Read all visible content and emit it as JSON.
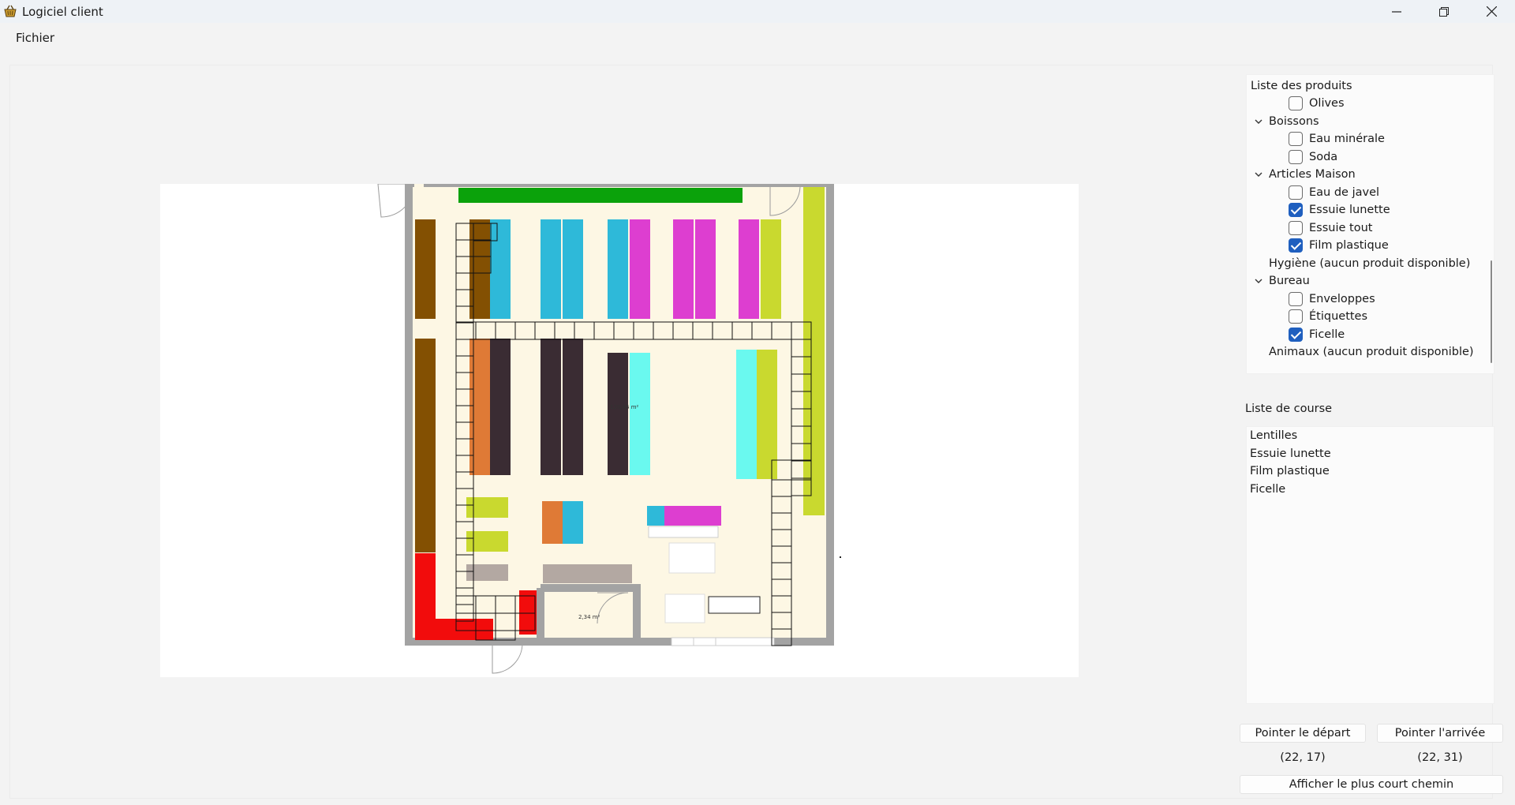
{
  "window": {
    "title": "Logiciel client",
    "icon": "shopping-basket-icon",
    "controls": [
      "minimize-icon",
      "maximize-icon",
      "close-icon"
    ]
  },
  "menu": {
    "fichier": "Fichier"
  },
  "map": {
    "area_label_main": "120,46 m²",
    "area_label_storage": "2,34 m²",
    "colors": {
      "wall": "#a3a3a3",
      "floor": "#fdf7e4",
      "green": "#0ba20b",
      "lime": "#c9d92f",
      "brown": "#835002",
      "cyan": "#2eb9d9",
      "magenta": "#dd3ed0",
      "orange": "#df7a36",
      "dark": "#3a2c33",
      "aqua": "#6af9ef",
      "red": "#f20c0c",
      "grey": "#b3a8a2"
    }
  },
  "tree": {
    "header": "Liste des produits",
    "items": [
      {
        "type": "product",
        "label": "Olives",
        "checked": false
      },
      {
        "type": "category",
        "label": "Boissons",
        "expanded": true
      },
      {
        "type": "product",
        "label": "Eau minérale",
        "checked": false
      },
      {
        "type": "product",
        "label": "Soda",
        "checked": false
      },
      {
        "type": "category",
        "label": "Articles Maison",
        "expanded": true
      },
      {
        "type": "product",
        "label": "Eau de javel",
        "checked": false
      },
      {
        "type": "product",
        "label": "Essuie lunette",
        "checked": true
      },
      {
        "type": "product",
        "label": "Essuie tout",
        "checked": false
      },
      {
        "type": "product",
        "label": "Film plastique",
        "checked": true
      },
      {
        "type": "category-empty",
        "label": "Hygiène (aucun produit disponible)"
      },
      {
        "type": "category",
        "label": "Bureau",
        "expanded": true
      },
      {
        "type": "product",
        "label": "Enveloppes",
        "checked": false
      },
      {
        "type": "product",
        "label": "Étiquettes",
        "checked": false
      },
      {
        "type": "product",
        "label": "Ficelle",
        "checked": true
      },
      {
        "type": "category-empty",
        "label": "Animaux (aucun produit disponible)"
      }
    ]
  },
  "course": {
    "label": "Liste de course",
    "items": [
      "Lentilles",
      "Essuie lunette",
      "Film plastique",
      "Ficelle"
    ]
  },
  "controls": {
    "depart_label": "Pointer le départ",
    "arrivee_label": "Pointer l'arrivée",
    "depart_coord": "(22, 17)",
    "arrivee_coord": "(22, 31)",
    "chemin_label": "Afficher le plus court chemin"
  }
}
